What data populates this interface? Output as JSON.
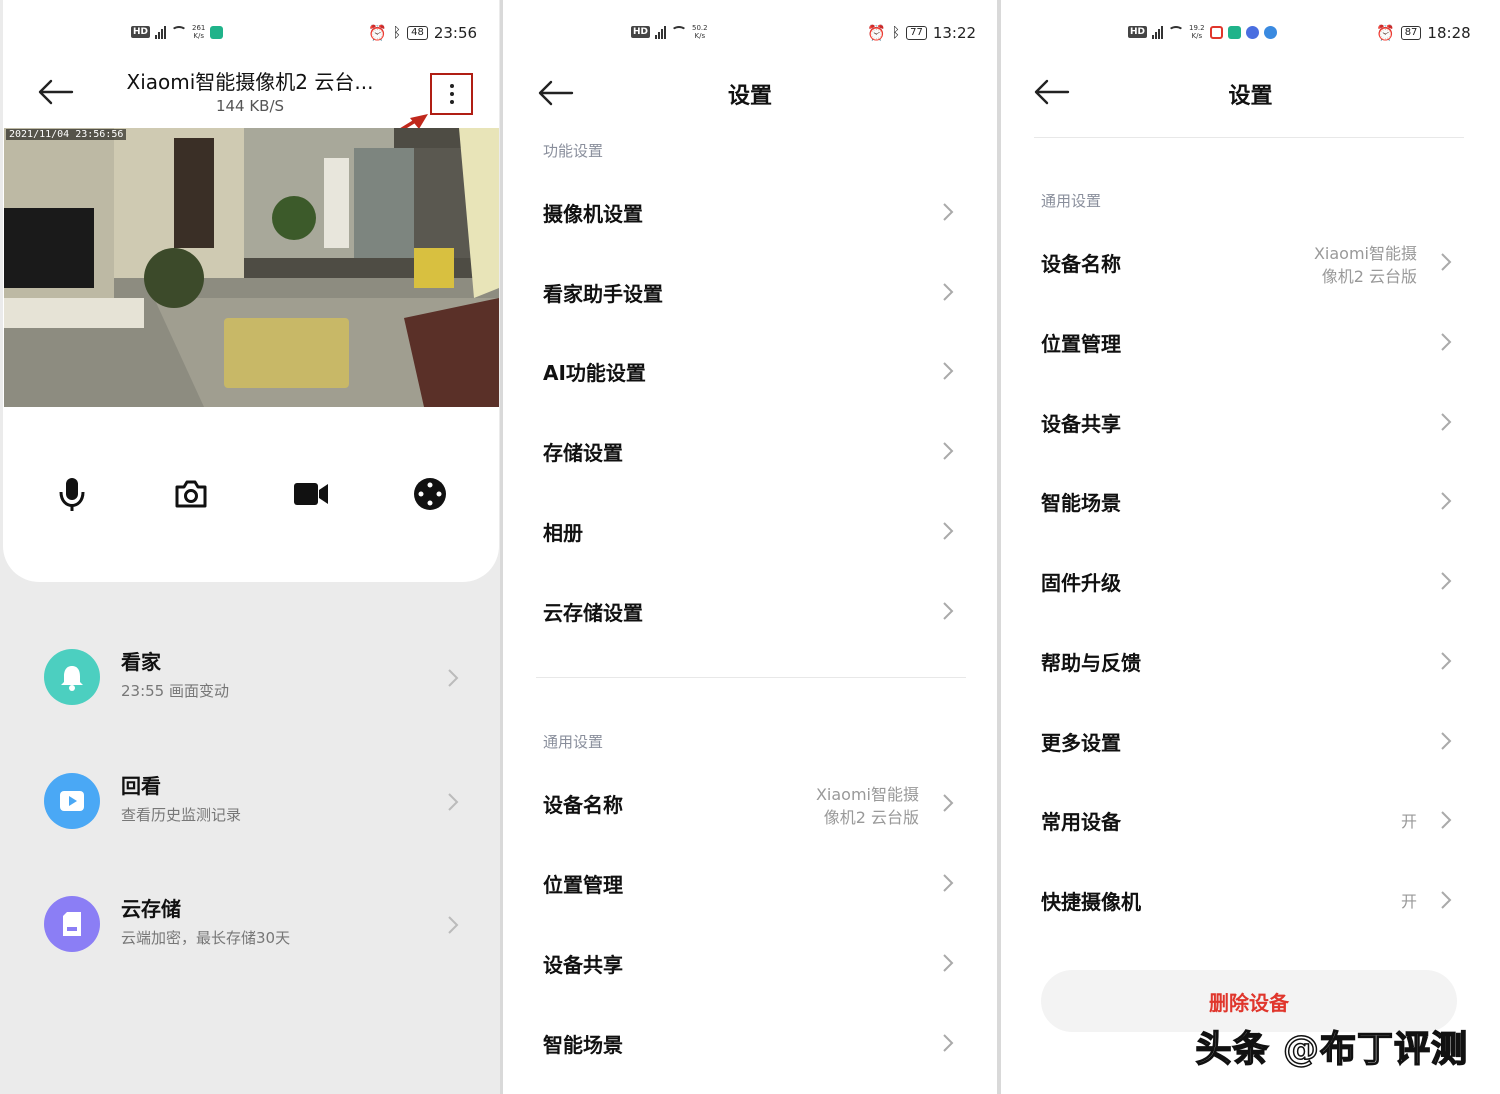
{
  "panel1": {
    "status": {
      "net_speed_value": "261",
      "net_speed_unit": "K/s",
      "battery": "48",
      "time": "23:56"
    },
    "title": "Xiaomi智能摄像机2 云台...",
    "subtitle": "144 KB/S",
    "video_timestamp": "2021/11/04 23:56:56",
    "controls": [
      "mic-icon",
      "camera-icon",
      "video-record-icon",
      "joystick-icon"
    ],
    "features": [
      {
        "title": "看家",
        "sub": "23:55 画面变动",
        "icon": "bell-icon",
        "color": "#4ccfc0"
      },
      {
        "title": "回看",
        "sub": "查看历史监测记录",
        "icon": "play-icon",
        "color": "#4aa8f5"
      },
      {
        "title": "云存储",
        "sub": "云端加密，最长存储30天",
        "icon": "sdcard-icon",
        "color": "#8b7ef5"
      }
    ]
  },
  "panel2": {
    "status": {
      "net_speed_value": "50.2",
      "net_speed_unit": "K/s",
      "battery": "77",
      "time": "13:22"
    },
    "title": "设置",
    "section1": "功能设置",
    "items1": [
      "摄像机设置",
      "看家助手设置",
      "AI功能设置",
      "存储设置",
      "相册",
      "云存储设置"
    ],
    "section2": "通用设置",
    "device_name_label": "设备名称",
    "device_name_value": "Xiaomi智能摄\n像机2 云台版",
    "items2": [
      "位置管理",
      "设备共享",
      "智能场景"
    ]
  },
  "panel3": {
    "status": {
      "net_speed_value": "19.2",
      "net_speed_unit": "K/s",
      "battery": "87",
      "time": "18:28"
    },
    "title": "设置",
    "section": "通用设置",
    "device_name_label": "设备名称",
    "device_name_value": "Xiaomi智能摄\n像机2 云台版",
    "items": [
      "位置管理",
      "设备共享",
      "智能场景",
      "固件升级",
      "帮助与反馈",
      "更多设置"
    ],
    "toggles": [
      {
        "label": "常用设备",
        "value": "开"
      },
      {
        "label": "快捷摄像机",
        "value": "开"
      }
    ],
    "delete_label": "删除设备"
  },
  "watermark": "头条 @布丁评测",
  "colors": {
    "accent_red": "#e0362c",
    "annotation_red": "#b01e14",
    "section_gray": "#8a8f9c"
  }
}
